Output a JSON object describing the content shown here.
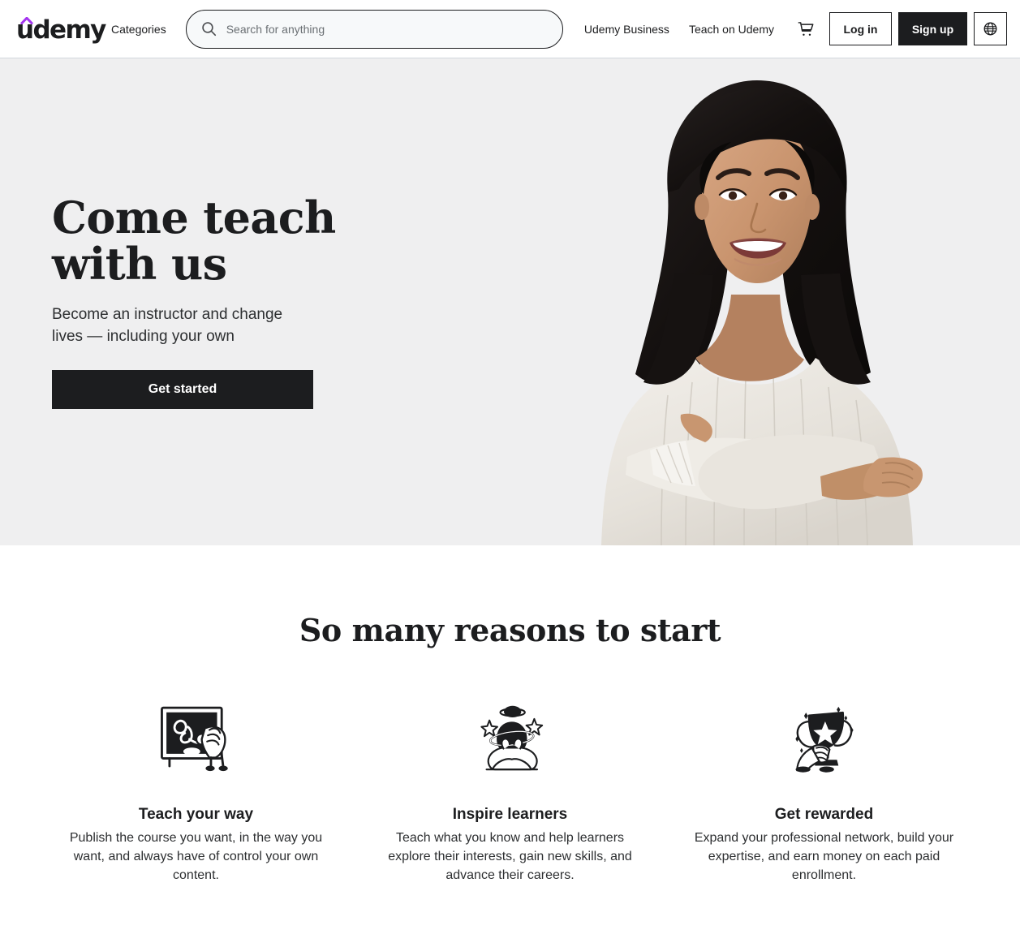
{
  "header": {
    "logo_text": "udemy",
    "logo_accent_color": "#a435f0",
    "categories_label": "Categories",
    "search": {
      "placeholder": "Search for anything",
      "value": "",
      "icon": "search-icon"
    },
    "nav_links": [
      {
        "label": "Udemy Business"
      },
      {
        "label": "Teach on Udemy"
      }
    ],
    "cart_icon": "shopping-cart-icon",
    "login_label": "Log in",
    "signup_label": "Sign up",
    "language_icon": "globe-icon"
  },
  "hero": {
    "title_line1": "Come teach",
    "title_line2": "with us",
    "subtitle": "Become an instructor and change lives — including your own",
    "cta_label": "Get started",
    "background_color": "#efeff0",
    "photo_alt": "Smiling instructor with arms crossed"
  },
  "reasons": {
    "heading": "So many reasons to start",
    "items": [
      {
        "icon": "chalkboard-icon",
        "heading": "Teach your way",
        "text": "Publish the course you want, in the way you want, and always have of control your own content."
      },
      {
        "icon": "planet-head-icon",
        "heading": "Inspire learners",
        "text": "Teach what you know and help learners explore their interests, gain new skills, and advance their careers."
      },
      {
        "icon": "trophy-icon",
        "heading": "Get rewarded",
        "text": "Expand your professional network, build your expertise, and earn money on each paid enrollment."
      }
    ]
  }
}
